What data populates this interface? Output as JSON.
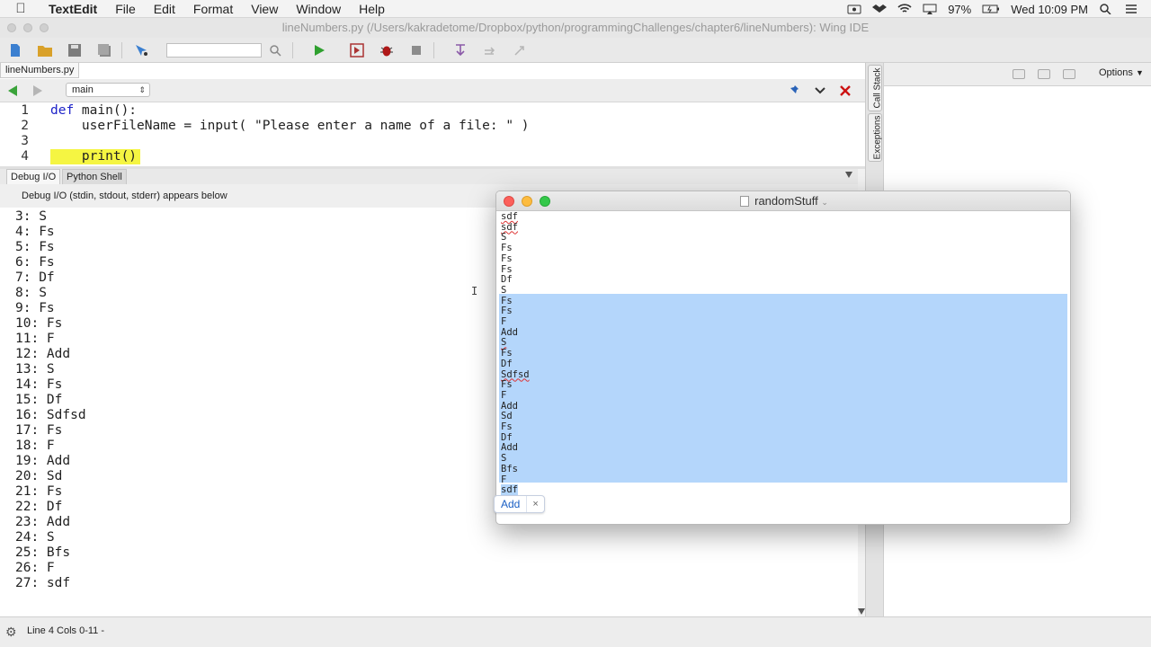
{
  "menubar": {
    "app": "TextEdit",
    "items": [
      "File",
      "Edit",
      "Format",
      "View",
      "Window",
      "Help"
    ],
    "battery": "97%",
    "clock": "Wed 10:09 PM"
  },
  "wing": {
    "title": "lineNumbers.py (/Users/kakradetome/Dropbox/python/programmingChallenges/chapter6/lineNumbers): Wing IDE",
    "file_tab": "lineNumbers.py",
    "scope": "main",
    "code_lines": [
      {
        "num": "1",
        "parts": [
          "def",
          " main():"
        ]
      },
      {
        "num": "2",
        "text": "    userFileName = input( \"Please enter a name of a file: \" )"
      },
      {
        "num": "3",
        "text": ""
      },
      {
        "num": "4",
        "text": "    print()"
      }
    ],
    "tool_tabs": [
      "Debug I/O",
      "Python Shell"
    ],
    "tool_header": "Debug I/O (stdin, stdout, stderr) appears below",
    "debug_lines": [
      "3: S",
      "4: Fs",
      "5: Fs",
      "6: Fs",
      "7: Df",
      "8: S",
      "9: Fs",
      "10: Fs",
      "11: F",
      "12: Add",
      "13: S",
      "14: Fs",
      "15: Df",
      "16: Sdfsd",
      "17: Fs",
      "18: F",
      "19: Add",
      "20: Sd",
      "21: Fs",
      "22: Df",
      "23: Add",
      "24: S",
      "25: Bfs",
      "26: F",
      "27: sdf"
    ],
    "side_tabs": [
      "Call Stack",
      "Exceptions"
    ],
    "options_label": "Options",
    "status": "Line 4 Cols 0-11 -"
  },
  "textedit": {
    "title": "randomStuff",
    "lines": [
      "sdf",
      "sdf",
      "S",
      "Fs",
      "Fs",
      "Fs",
      "Df",
      "S",
      "Fs",
      "Fs",
      "F",
      "Add",
      "S",
      "Fs",
      "Df",
      "Sdfsd",
      "Fs",
      "F",
      "Add",
      "Sd",
      "Fs",
      "Df",
      "Add",
      "S",
      "Bfs",
      "F",
      "sdf"
    ],
    "find_label": "Add",
    "find_close": "×"
  }
}
